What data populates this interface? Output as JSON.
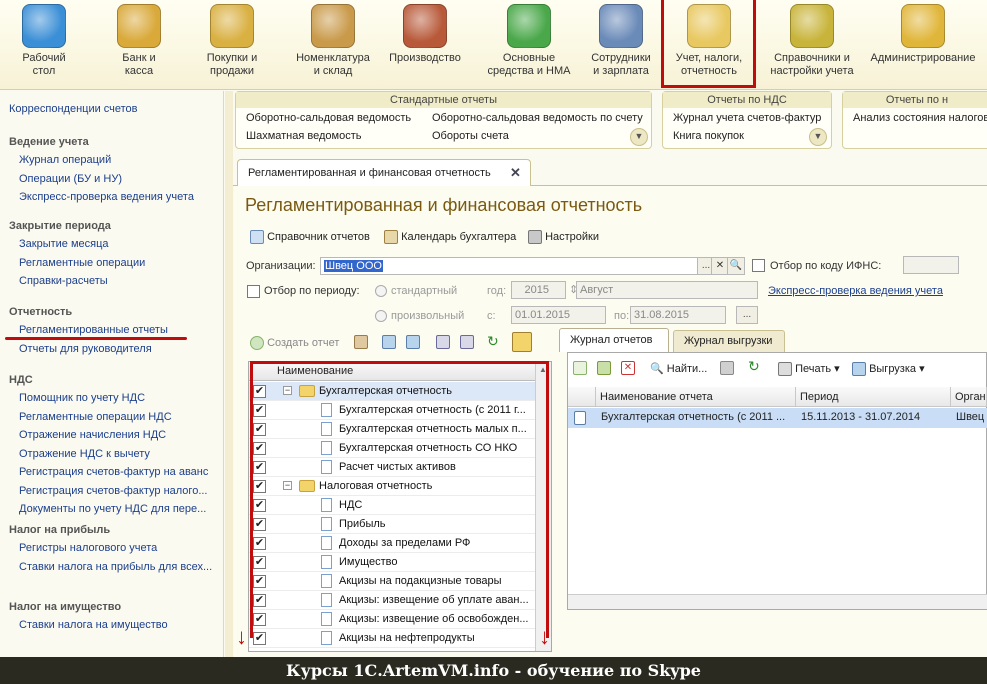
{
  "top_sections": [
    {
      "label": "Рабочий\nстол",
      "icon": "desktop-flag-icon",
      "color": "#3b8fd6"
    },
    {
      "label": "Банк и\nкасса",
      "icon": "coins-icon",
      "color": "#d9a93a"
    },
    {
      "label": "Покупки и\nпродажи",
      "icon": "truck-icon",
      "color": "#d9b042"
    },
    {
      "label": "Номенклатура\nи склад",
      "icon": "boxes-icon",
      "color": "#c99a4a"
    },
    {
      "label": "Производство",
      "icon": "toolbox-icon",
      "color": "#b85a3a"
    },
    {
      "label": "Основные\nсредства и НМА",
      "icon": "factory-icon",
      "color": "#4aa84a"
    },
    {
      "label": "Сотрудники\nи зарплата",
      "icon": "worker-icon",
      "color": "#6a8ab8"
    },
    {
      "label": "Учет, налоги,\nотчетность",
      "icon": "folder-report-icon",
      "color": "#e8c860"
    },
    {
      "label": "Справочники и\nнастройки учета",
      "icon": "binders-icon",
      "color": "#c8b43a"
    },
    {
      "label": "Администрирование",
      "icon": "database-icon",
      "color": "#e0b63a"
    }
  ],
  "left_nav": {
    "top_link": "Корреспонденции счетов",
    "groups": [
      {
        "title": "Ведение учета",
        "items": [
          "Журнал операций",
          "Операции (БУ и НУ)",
          "Экспресс-проверка ведения учета"
        ]
      },
      {
        "title": "Закрытие периода",
        "items": [
          "Закрытие месяца",
          "Регламентные операции",
          "Справки-расчеты"
        ]
      },
      {
        "title": "Отчетность",
        "items": [
          "Регламентированные отчеты",
          "Отчеты для руководителя"
        ]
      },
      {
        "title": "НДС",
        "items": [
          "Помощник по учету НДС",
          "Регламентные операции НДС",
          "Отражение начисления НДС",
          "Отражение НДС к вычету",
          "Регистрация счетов-фактур на аванс",
          "Регистрация счетов-фактур налого...",
          "Документы по учету НДС для пере..."
        ]
      },
      {
        "title": "Налог на прибыль",
        "items": [
          "Регистры налогового учета",
          "Ставки налога на прибыль для всех..."
        ]
      },
      {
        "title": "Налог на имущество",
        "items": [
          "Ставки налога на имущество"
        ]
      }
    ]
  },
  "panels": {
    "standard": {
      "title": "Стандартные отчеты",
      "col1": [
        "Оборотно-сальдовая ведомость",
        "Шахматная ведомость"
      ],
      "col2": [
        "Оборотно-сальдовая ведомость по счету",
        "Обороты счета"
      ]
    },
    "vat": {
      "title": "Отчеты по НДС",
      "items": [
        "Журнал учета счетов-фактур",
        "Книга покупок"
      ]
    },
    "other": {
      "title": "Отчеты по н",
      "items": [
        "Анализ состояния налогов"
      ]
    }
  },
  "tab": {
    "label": "Регламентированная и финансовая отчетность",
    "close": "✕"
  },
  "form": {
    "title": "Регламентированная и финансовая отчетность",
    "toolbar": {
      "reports_dir": "Справочник отчетов",
      "calendar": "Календарь бухгалтера",
      "settings": "Настройки"
    },
    "org_label": "Организации:",
    "org_value": "Швец ООО",
    "ifns_label": "Отбор по коду ИФНС:",
    "period_label": "Отбор по периоду:",
    "standard_label": "стандартный",
    "year_label": "год:",
    "year_value": "2015",
    "month_value": "Август",
    "express_link": "Экспресс-проверка ведения учета",
    "custom_label": "произвольный",
    "from_label": "с:",
    "from_value": "01.01.2015",
    "to_label": "по:",
    "to_value": "31.08.2015",
    "dots": "..."
  },
  "tree": {
    "create_label": "Создать отчет",
    "header": "Наименование",
    "rows": [
      {
        "label": "Бухгалтерская отчетность",
        "level": 0,
        "folder": true
      },
      {
        "label": "Бухгалтерская отчетность (с 2011 г...",
        "level": 1,
        "folder": false
      },
      {
        "label": "Бухгалтерская отчетность малых п...",
        "level": 1,
        "folder": false
      },
      {
        "label": "Бухгалтерская отчетность СО НКО",
        "level": 1,
        "folder": false
      },
      {
        "label": "Расчет чистых активов",
        "level": 1,
        "folder": false
      },
      {
        "label": "Налоговая отчетность",
        "level": 0,
        "folder": true
      },
      {
        "label": "НДС",
        "level": 1,
        "folder": false
      },
      {
        "label": "Прибыль",
        "level": 1,
        "folder": false
      },
      {
        "label": "Доходы за пределами РФ",
        "level": 1,
        "folder": false
      },
      {
        "label": "Имущество",
        "level": 1,
        "folder": false
      },
      {
        "label": "Акцизы на подакцизные товары",
        "level": 1,
        "folder": false
      },
      {
        "label": "Акцизы: извещение об уплате аван...",
        "level": 1,
        "folder": false
      },
      {
        "label": "Акцизы: извещение об освобожден...",
        "level": 1,
        "folder": false
      },
      {
        "label": "Акцизы на нефтепродукты",
        "level": 1,
        "folder": false
      }
    ]
  },
  "journal": {
    "tabs": [
      "Журнал отчетов",
      "Журнал выгрузки"
    ],
    "find": "Найти...",
    "print": "Печать",
    "upload": "Выгрузка",
    "columns": [
      "Наименование отчета",
      "Период",
      "Орган"
    ],
    "rows": [
      {
        "name": "Бухгалтерская отчетность (с 2011 ...",
        "period": "15.11.2013 - 31.07.2014",
        "org": "Швец"
      }
    ]
  },
  "footer": "Курсы 1С.ArtemVM.info - обучение по Skype"
}
